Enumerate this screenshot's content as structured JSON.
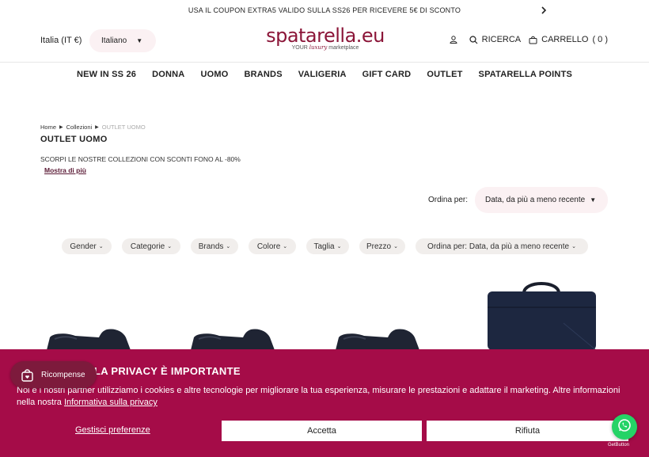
{
  "announcement": {
    "text": "USA IL COUPON EXTRA5 VALIDO SULLA SS26 PER RICEVERE 5€ DI SCONTO",
    "arrow_icon": "chevron-right-icon"
  },
  "header": {
    "country": "Italia (IT €)",
    "language": "Italiano",
    "logo": {
      "brand": "spatarella.eu",
      "tag_prefix": "YOUR",
      "tag_script": "luxury",
      "tag_suffix": "marketplace"
    },
    "search_label": "RICERCA",
    "cart_label": "CARRELLO",
    "cart_count": "( 0 )"
  },
  "nav": {
    "items": [
      "NEW IN SS 26",
      "DONNA",
      "UOMO",
      "BRANDS",
      "VALIGERIA",
      "GIFT CARD",
      "OUTLET",
      "SPATARELLA POINTS"
    ]
  },
  "breadcrumb": {
    "home": "Home",
    "collections": "Collezioni",
    "current": "OUTLET UOMO"
  },
  "page": {
    "title": "OUTLET UOMO",
    "description": "SCORPI LE NOSTRE COLLEZIONI CON SCONTI FONO AL -80%",
    "show_more": "Mostra di più"
  },
  "sort": {
    "label": "Ordina per:",
    "value": "Data, da più a meno recente"
  },
  "filters": {
    "gender": "Gender",
    "categorie": "Categorie",
    "brands": "Brands",
    "colore": "Colore",
    "taglia": "Taglia",
    "prezzo": "Prezzo",
    "ordina_label": "Ordina per:",
    "ordina_value": "Data, da più a meno recente"
  },
  "cookie": {
    "title": "LA PRIVACY È IMPORTANTE",
    "text": "Noi e i nostri partner utilizziamo i cookies e altre tecnologie per migliorare la tua esperienza, misurare le prestazioni e adattare il marketing. Altre informazioni nella nostra",
    "link": "Informativa sulla privacy",
    "manage": "Gestisci preferenze",
    "accept": "Accetta",
    "reject": "Rifiuta"
  },
  "rewards": {
    "label": "Ricompense"
  },
  "getbutton": "GetButton",
  "colors": {
    "brand": "#8b1538",
    "banner": "#a50c48",
    "whatsapp": "#25d366",
    "chip": "#f1eeec",
    "pill": "#fbf1f3"
  }
}
